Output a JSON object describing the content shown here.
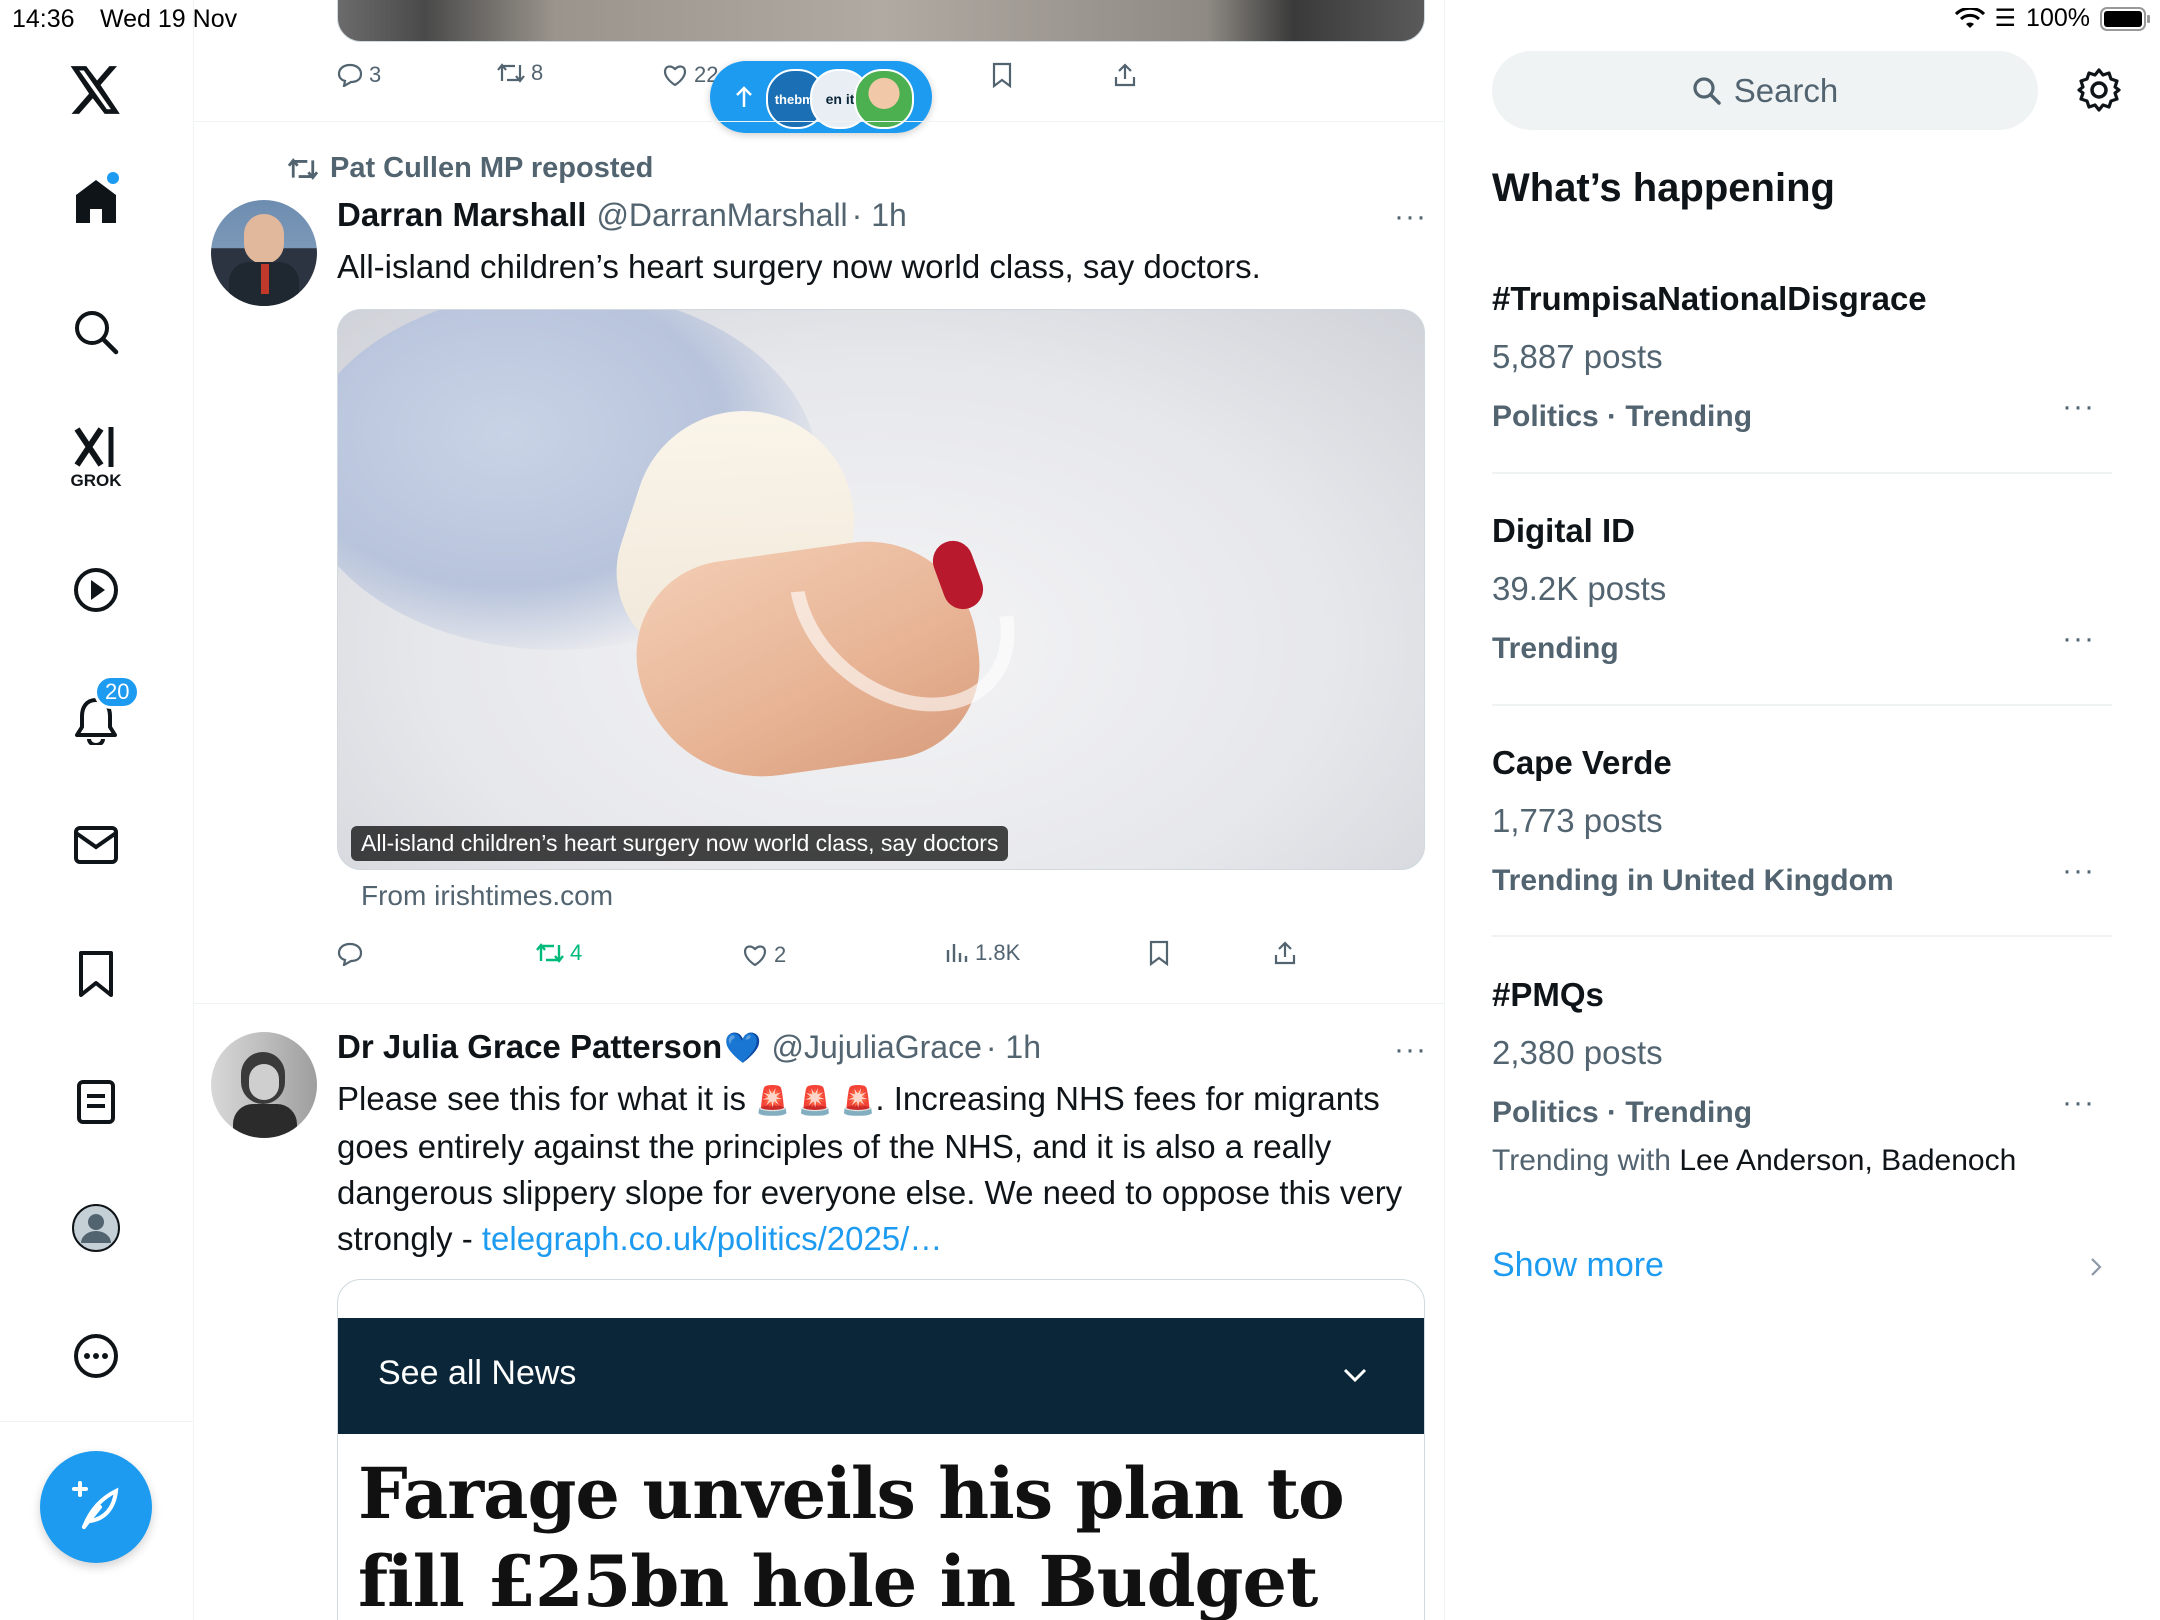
{
  "status_bar": {
    "time": "14:36",
    "date": "Wed 19 Nov",
    "battery": "100%"
  },
  "nav": {
    "grok_label": "GROK",
    "notifications_badge": "20"
  },
  "top_tweet_actions": {
    "replies": "3",
    "reposts": "8",
    "likes": "22"
  },
  "new_posts_pill": {
    "avatar1_text": "thebmj",
    "avatar2_text": "en it"
  },
  "tweet1": {
    "repost_label": "Pat Cullen MP reposted",
    "name": "Darran Marshall",
    "handle": "@DarranMarshall",
    "time": "· 1h",
    "text": "All-island children’s heart surgery now world class, say doctors.",
    "card_caption": "All-island children’s heart surgery now world class, say doctors",
    "card_source": "From irishtimes.com",
    "replies": "",
    "reposts": "4",
    "likes": "2",
    "views": "1.8K"
  },
  "tweet2": {
    "name": "Dr Julia Grace Patterson",
    "name_emoji": "💙",
    "handle": "@JujuliaGrace",
    "time": "· 1h",
    "text_1": "Please see this for what it is",
    "emoji": "🚨 🚨 🚨",
    "text_2": ". Increasing NHS fees for migrants goes entirely against the principles of the NHS, and it is also a really dangerous slippery slope for everyone else. We need to oppose this very strongly -",
    "link": "telegraph.co.uk/politics/2025/…",
    "card_banner": "See all News",
    "card_headline": "Farage unveils his plan to fill £25bn hole in Budget"
  },
  "search": {
    "placeholder": "Search"
  },
  "sidebar": {
    "heading": "What’s happening",
    "trends": [
      {
        "title": "#TrumpisaNationalDisgrace",
        "count": "5,887 posts",
        "meta": "Politics · Trending"
      },
      {
        "title": "Digital ID",
        "count": "39.2K posts",
        "meta": "Trending"
      },
      {
        "title": "Cape Verde",
        "count": "1,773 posts",
        "meta": "Trending in United Kingdom"
      },
      {
        "title": "#PMQs",
        "count": "2,380 posts",
        "meta": "Politics · Trending",
        "with_label": "Trending with",
        "with_names": "Lee Anderson, Badenoch"
      }
    ],
    "show_more": "Show more"
  },
  "colors": {
    "accent": "#1d9bf0",
    "repost_green": "#00ba7c",
    "secondary": "#536471",
    "banner": "#0a2638"
  }
}
